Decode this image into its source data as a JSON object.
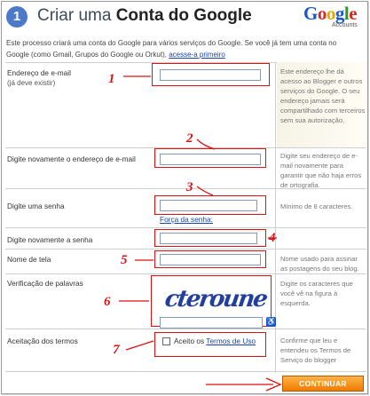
{
  "header": {
    "step_number": "1",
    "title_prefix": "Criar uma",
    "title_bold": "Conta do Google",
    "logo_letters": [
      "G",
      "o",
      "o",
      "g",
      "l",
      "e"
    ],
    "logo_subtitle": "Accounts"
  },
  "intro": {
    "text": "Este processo criará uma conta do Google para vários serviços do Google. Se você já tem uma conta no Google (como Gmail, Grupos do Google ou Orkut),",
    "link": "acesse-a primeiro"
  },
  "fields": {
    "email": {
      "label": "Endereço de e-mail",
      "sublabel": "(já deve existir)",
      "value": "",
      "help": "Este endereço lhe dá acesso ao Blogger e outros serviços do Google. O seu endereço jamais será compartilhado com terceiros sem sua autorização."
    },
    "email_confirm": {
      "label": "Digite novamente o endereço de e-mail",
      "value": "",
      "help": "Digite seu endereço de e-mail novamente para garantir que não haja erros de ortografia."
    },
    "password": {
      "label": "Digite uma senha",
      "value": "",
      "strength_link": "Força da senha:",
      "help": "Mínimo de 8 caracteres."
    },
    "password_confirm": {
      "label": "Digite novamente a senha",
      "value": ""
    },
    "display_name": {
      "label": "Nome de tela",
      "value": "",
      "help": "Nome usado para assinar as postagens do seu blog."
    },
    "captcha": {
      "label": "Verificação de palavras",
      "image_text": "cteroune",
      "value": "",
      "help": "Digite os caracteres que você vê na figura à esquerda."
    },
    "terms": {
      "label": "Aceitação dos termos",
      "checkbox_prefix": "Aceito os",
      "link": "Termos de Uso",
      "checked": false,
      "help": "Confirme que leu e entendeu os Termos de Serviço do blogger"
    }
  },
  "annotations": [
    "1",
    "2",
    "3",
    "4",
    "5",
    "6",
    "7"
  ],
  "annotation_color": "#dd1111",
  "continue_label": "CONTINUAR",
  "colors": {
    "accent": "#4a7ac8",
    "link": "#1a45a8",
    "button": "#f07a00"
  }
}
